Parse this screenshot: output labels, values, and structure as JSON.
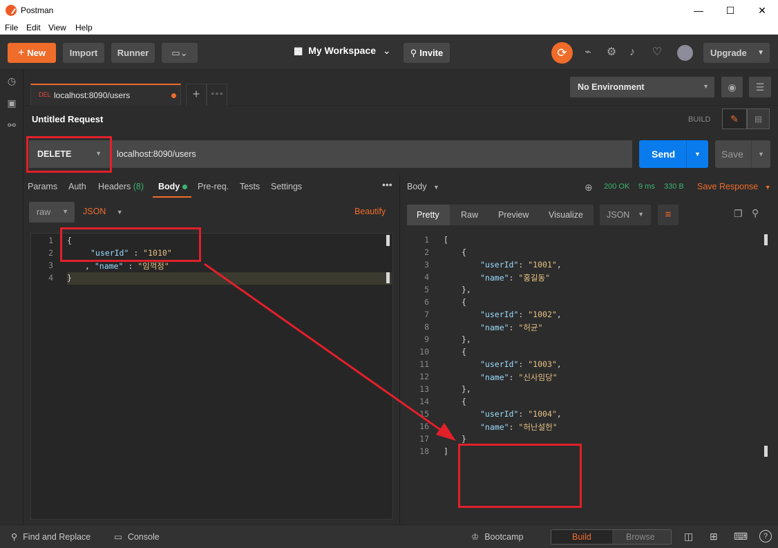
{
  "window": {
    "title": "Postman",
    "minimize": "—",
    "maximize": "☐",
    "close": "✕"
  },
  "menu": [
    "File",
    "Edit",
    "View",
    "Help"
  ],
  "header": {
    "new_label": "New",
    "import_label": "Import",
    "runner_label": "Runner",
    "workspace_label": "My Workspace",
    "invite_label": "Invite",
    "upgrade_label": "Upgrade"
  },
  "tabs": [
    {
      "method": "DEL",
      "title": "localhost:8090/users"
    }
  ],
  "environment": {
    "selected": "No Environment"
  },
  "request": {
    "title": "Untitled Request",
    "build_label": "BUILD",
    "method": "DELETE",
    "url": "localhost:8090/users",
    "send_label": "Send",
    "save_label": "Save"
  },
  "request_tabs": {
    "params": "Params",
    "auth": "Auth",
    "headers": "Headers",
    "headers_count": "(8)",
    "body": "Body",
    "prereq": "Pre-req.",
    "tests": "Tests",
    "settings": "Settings"
  },
  "body_options": {
    "mode": "raw",
    "format": "JSON",
    "beautify": "Beautify"
  },
  "request_body": {
    "line_numbers": [
      "1",
      "2",
      "3",
      "4"
    ],
    "l1": "{",
    "l2_key": "\"userId\"",
    "l2_sep": " : ",
    "l2_val": "\"1010\"",
    "l3_pre": ", ",
    "l3_key": "\"name\"",
    "l3_sep": " : ",
    "l3_val": "\"임꺽정\"",
    "l4": "}"
  },
  "response": {
    "body_label": "Body",
    "status": "200 OK",
    "time": "9 ms",
    "size": "330 B",
    "save_label": "Save Response",
    "views": [
      "Pretty",
      "Raw",
      "Preview",
      "Visualize"
    ],
    "format": "JSON",
    "line_numbers": [
      "1",
      "2",
      "3",
      "4",
      "5",
      "6",
      "7",
      "8",
      "9",
      "10",
      "11",
      "12",
      "13",
      "14",
      "15",
      "16",
      "17",
      "18"
    ],
    "users": [
      {
        "id": "\"1001\"",
        "name": "\"홍길동\""
      },
      {
        "id": "\"1002\"",
        "name": "\"허균\""
      },
      {
        "id": "\"1003\"",
        "name": "\"신사임당\""
      },
      {
        "id": "\"1004\"",
        "name": "\"허난설헌\""
      }
    ],
    "key_userid": "\"userId\"",
    "key_name": "\"name\"",
    "open_bracket": "[",
    "close_bracket": "]"
  },
  "footer": {
    "find_replace": "Find and Replace",
    "console": "Console",
    "bootcamp": "Bootcamp",
    "build": "Build",
    "browse": "Browse"
  },
  "colors": {
    "accent": "#ef6c2a",
    "send_blue": "#097bed",
    "status_green": "#3cb371",
    "annotation_red": "#e2202a"
  }
}
